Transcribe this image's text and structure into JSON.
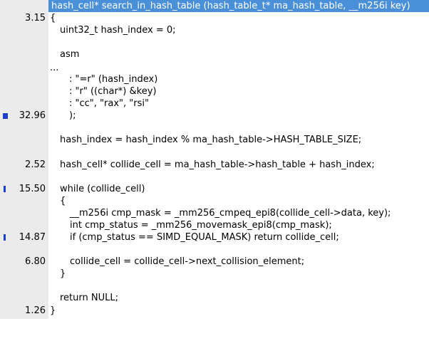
{
  "header": {
    "title": "hash_cell* search_in_hash_table (hash_table_t* ma_hash_table, __m256i key)"
  },
  "lines": [
    {
      "pct": "3.15",
      "text": "{"
    },
    {
      "pct": "",
      "text": "uint32_t hash_index = 0;"
    },
    {
      "pct": "",
      "text": ""
    },
    {
      "pct": "",
      "text": "asm"
    },
    {
      "pct": "",
      "text": "..."
    },
    {
      "pct": "",
      "text": ": \"=r\" (hash_index)"
    },
    {
      "pct": "",
      "text": ": \"r\" ((char*) &key)"
    },
    {
      "pct": "",
      "text": ": \"cc\", \"rax\", \"rsi\""
    },
    {
      "pct": "32.96",
      "text": ");"
    },
    {
      "pct": "",
      "text": ""
    },
    {
      "pct": "",
      "text": "hash_index = hash_index % ma_hash_table->HASH_TABLE_SIZE;"
    },
    {
      "pct": "",
      "text": ""
    },
    {
      "pct": "2.52",
      "text": "hash_cell* collide_cell = ma_hash_table->hash_table + hash_index;"
    },
    {
      "pct": "",
      "text": ""
    },
    {
      "pct": "15.50",
      "text": "while (collide_cell)"
    },
    {
      "pct": "",
      "text": "{"
    },
    {
      "pct": "",
      "text": "__m256i cmp_mask = _mm256_cmpeq_epi8(collide_cell->data, key);"
    },
    {
      "pct": "",
      "text": "int cmp_status = _mm256_movemask_epi8(cmp_mask);"
    },
    {
      "pct": "14.87",
      "text": "if (cmp_status == SIMD_EQUAL_MASK) return collide_cell;"
    },
    {
      "pct": "",
      "text": ""
    },
    {
      "pct": "6.80",
      "text": "collide_cell = collide_cell->next_collision_element;"
    },
    {
      "pct": "",
      "text": "}"
    },
    {
      "pct": "",
      "text": ""
    },
    {
      "pct": "",
      "text": "return NULL;"
    },
    {
      "pct": "1.26",
      "text": "}"
    }
  ],
  "colors": {
    "header_bg": "#4a90d9",
    "gutter_bg": "#ebebeb",
    "marker": "#1c3fd1"
  },
  "icons": {
    "hot_marker": "bookmark-marker-icon"
  }
}
